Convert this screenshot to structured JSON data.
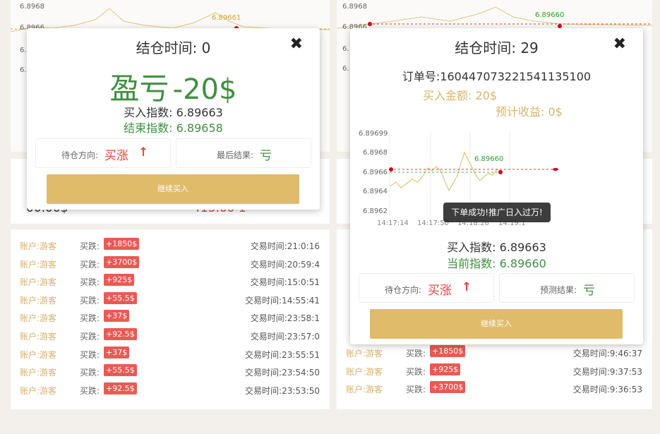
{
  "left": {
    "bg_chart": {
      "ticks": [
        "6.8968",
        "6.8966",
        "6.8",
        "6."
      ],
      "marker_value": "6.89661"
    },
    "mid_row": {
      "left_value": "00.00$",
      "right_value": "413.00 1"
    },
    "trades": [
      {
        "account": "账户:游客",
        "action": "买跌:",
        "amount": "+1850$",
        "time": "交易时间:21:0:16"
      },
      {
        "account": "账户:游客",
        "action": "买跌:",
        "amount": "+3700$",
        "time": "交易时间:20:59:4"
      },
      {
        "account": "账户:游客",
        "action": "买跌:",
        "amount": "+925$",
        "time": "交易时间:15:0:51"
      },
      {
        "account": "账户:游客",
        "action": "买跌:",
        "amount": "+55.5$",
        "time": "交易时间:14:55:41"
      },
      {
        "account": "账户:游客",
        "action": "买跌:",
        "amount": "+37$",
        "time": "交易时间:23:58:1"
      },
      {
        "account": "账户:游客",
        "action": "买跌:",
        "amount": "+92.5$",
        "time": "交易时间:23:57:0"
      },
      {
        "account": "账户:游客",
        "action": "买跌:",
        "amount": "+37$",
        "time": "交易时间:23:55:51"
      },
      {
        "account": "账户:游客",
        "action": "买跌:",
        "amount": "+55.5$",
        "time": "交易时间:23:54:50"
      },
      {
        "account": "账户:游客",
        "action": "买跌:",
        "amount": "+92.5$",
        "time": "交易时间:23:53:50"
      }
    ],
    "modal": {
      "title": "结仓时间: 0",
      "close_icon": "✖",
      "pl_label": "盈亏",
      "pl_value": "-20$",
      "buy_index": "买入指数: 6.89663",
      "end_index": "结束指数: 6.89658",
      "direction_key": "待仓方向:",
      "direction_value": "买涨",
      "arrow_icon": "↑",
      "result_key": "最后结果:",
      "result_value": "亏",
      "continue_button": "继续买入"
    }
  },
  "right": {
    "bg_chart": {
      "ticks": [
        "6.8968",
        "6.8966",
        "6.",
        "6."
      ],
      "marker_value": "6.89660"
    },
    "trades": [
      {
        "account": "账户:游客",
        "action": "买跌:",
        "amount": "+1850$",
        "time": "交易时间:9:46:37"
      },
      {
        "account": "账户:游客",
        "action": "买跌:",
        "amount": "+925$",
        "time": "交易时间:9:37:53"
      },
      {
        "account": "账户:游客",
        "action": "买跌:",
        "amount": "+3700$",
        "time": "交易时间:9:36:53"
      }
    ],
    "modal": {
      "title": "结仓时间: 29",
      "close_icon": "✖",
      "order_no": "订单号:1604470732215411351​00",
      "buy_amount": "买入金额: 20$",
      "expected_profit": "预计收益: 0$",
      "chart": {
        "y_ticks": [
          "6.89699",
          "6.8968",
          "6.8966",
          "6.8964",
          "6.8962"
        ],
        "x_ticks": [
          "14:17:14",
          "14:17:50",
          "14:18:26",
          "14:19:1"
        ],
        "marker_label": "6.89660"
      },
      "toast": "下单成功!推广日入过万!",
      "buy_index": "买入指数: 6.89663",
      "current_index": "当前指数: 6.89660",
      "direction_key": "待仓方向:",
      "direction_value": "买涨",
      "arrow_icon": "↑",
      "result_key": "预测结果:",
      "result_value": "亏",
      "continue_button": "继续买入"
    }
  },
  "colors": {
    "gold": "#d9b56b",
    "button_gold": "#e0bb6a",
    "green": "#3f8f3f",
    "red": "#e6453c",
    "badge_red": "#e85a54"
  }
}
